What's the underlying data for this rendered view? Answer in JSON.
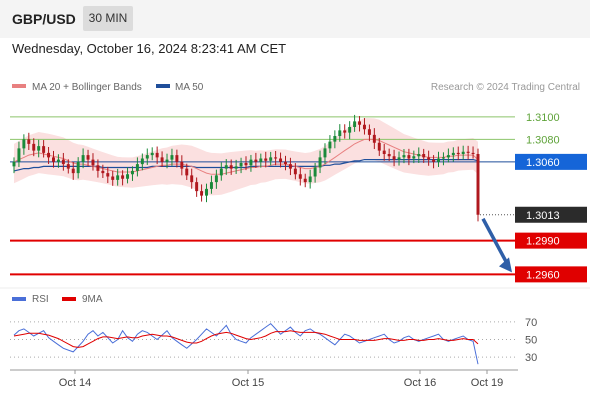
{
  "header": {
    "symbol": "GBP/USD",
    "timeframe": "30 MIN"
  },
  "datetime": "Wednesday, October 16, 2024 8:23:41 AM CET",
  "legend": {
    "ma20": "MA 20 + Bollinger Bands",
    "ma50": "MA 50",
    "credit": "Research © 2024 Trading Central",
    "rsi": "RSI",
    "rsi_ma": "9MA"
  },
  "colors": {
    "ma20": "#e88080",
    "ma50": "#1f4e9a",
    "band_fill": "#fbe0e0",
    "up_candle": "#1a8a3a",
    "down_candle": "#b0181e",
    "resistance": "#8cc46a",
    "support": "#e00000",
    "pivot_label": "#1565d8",
    "price_label": "#2b2b2b",
    "arrow": "#2f5fa8",
    "rsi": "#4a6fd8",
    "rsi_ma": "#e00000"
  },
  "chart_data": [
    {
      "type": "candlestick",
      "x_ticks": [
        "Oct 14",
        "Oct 15",
        "Oct 16",
        "Oct 19"
      ],
      "ylim": [
        1.2955,
        1.3115
      ],
      "levels": [
        {
          "value": 1.31,
          "label": "1.3100",
          "kind": "resistance"
        },
        {
          "value": 1.308,
          "label": "1.3080",
          "kind": "resistance"
        },
        {
          "value": 1.306,
          "label": "1.3060",
          "kind": "pivot"
        },
        {
          "value": 1.3013,
          "label": "1.3013",
          "kind": "last_price"
        },
        {
          "value": 1.299,
          "label": "1.2990",
          "kind": "support"
        },
        {
          "value": 1.296,
          "label": "1.2960",
          "kind": "support"
        }
      ],
      "closes": [
        1.306,
        1.3072,
        1.308,
        1.3076,
        1.307,
        1.3074,
        1.3068,
        1.3064,
        1.306,
        1.3062,
        1.3058,
        1.3054,
        1.305,
        1.306,
        1.3066,
        1.3062,
        1.3057,
        1.3052,
        1.305,
        1.3047,
        1.3044,
        1.3048,
        1.3045,
        1.3049,
        1.3052,
        1.3058,
        1.3063,
        1.3066,
        1.3068,
        1.3064,
        1.306,
        1.3062,
        1.3066,
        1.306,
        1.3054,
        1.3048,
        1.3042,
        1.3034,
        1.303,
        1.3036,
        1.3042,
        1.3048,
        1.3054,
        1.3057,
        1.3054,
        1.3056,
        1.3059,
        1.3057,
        1.3062,
        1.306,
        1.3063,
        1.3061,
        1.3064,
        1.3063,
        1.306,
        1.3058,
        1.3054,
        1.3049,
        1.3045,
        1.3042,
        1.3047,
        1.3055,
        1.3064,
        1.3072,
        1.3078,
        1.3083,
        1.3088,
        1.3086,
        1.3091,
        1.3096,
        1.3093,
        1.3089,
        1.3084,
        1.3077,
        1.307,
        1.3067,
        1.3065,
        1.3062,
        1.3064,
        1.3066,
        1.3063,
        1.3065,
        1.3067,
        1.3064,
        1.3062,
        1.306,
        1.3063,
        1.3064,
        1.3066,
        1.3068,
        1.3067,
        1.3069,
        1.3068,
        1.3067,
        1.3013
      ],
      "ma20": [
        1.306,
        1.3062,
        1.3064,
        1.3066,
        1.3067,
        1.3068,
        1.3067,
        1.3066,
        1.3065,
        1.3064,
        1.3063,
        1.3061,
        1.3059,
        1.3058,
        1.3058,
        1.3057,
        1.3056,
        1.3055,
        1.3054,
        1.3053,
        1.3052,
        1.3051,
        1.3051,
        1.3051,
        1.3051,
        1.3052,
        1.3053,
        1.3054,
        1.3055,
        1.3056,
        1.3057,
        1.3057,
        1.3058,
        1.3058,
        1.3058,
        1.3057,
        1.3056,
        1.3054,
        1.3052,
        1.305,
        1.3049,
        1.3049,
        1.3049,
        1.305,
        1.3051,
        1.3052,
        1.3053,
        1.3054,
        1.3055,
        1.3055,
        1.3056,
        1.3056,
        1.3057,
        1.3058,
        1.3058,
        1.3058,
        1.3057,
        1.3056,
        1.3055,
        1.3054,
        1.3054,
        1.3055,
        1.3056,
        1.3058,
        1.3061,
        1.3064,
        1.3067,
        1.307,
        1.3073,
        1.3076,
        1.3078,
        1.308,
        1.308,
        1.308,
        1.3079,
        1.3077,
        1.3075,
        1.3073,
        1.3071,
        1.3069,
        1.3068,
        1.3067,
        1.3066,
        1.3065,
        1.3064,
        1.3064,
        1.3064,
        1.3064,
        1.3065,
        1.3065,
        1.3066,
        1.3066,
        1.3066,
        1.3066,
        1.3062
      ],
      "ma50": [
        1.3052,
        1.3053,
        1.3054,
        1.3054,
        1.3055,
        1.3055,
        1.3056,
        1.3056,
        1.3056,
        1.3056,
        1.3056,
        1.3056,
        1.3056,
        1.3056,
        1.3056,
        1.3056,
        1.3056,
        1.3056,
        1.3055,
        1.3055,
        1.3055,
        1.3055,
        1.3055,
        1.3055,
        1.3055,
        1.3055,
        1.3055,
        1.3055,
        1.3056,
        1.3056,
        1.3056,
        1.3056,
        1.3056,
        1.3056,
        1.3056,
        1.3056,
        1.3056,
        1.3055,
        1.3055,
        1.3055,
        1.3055,
        1.3055,
        1.3055,
        1.3055,
        1.3055,
        1.3055,
        1.3055,
        1.3055,
        1.3056,
        1.3056,
        1.3056,
        1.3056,
        1.3056,
        1.3056,
        1.3056,
        1.3056,
        1.3056,
        1.3056,
        1.3056,
        1.3056,
        1.3056,
        1.3056,
        1.3056,
        1.3057,
        1.3057,
        1.3058,
        1.3058,
        1.3059,
        1.306,
        1.3061,
        1.3061,
        1.3062,
        1.3062,
        1.3062,
        1.3062,
        1.3062,
        1.3062,
        1.3062,
        1.3062,
        1.3062,
        1.3062,
        1.3062,
        1.3062,
        1.3062,
        1.3062,
        1.3062,
        1.3062,
        1.3062,
        1.3062,
        1.3062,
        1.3062,
        1.3062,
        1.3062,
        1.3062,
        1.3061
      ]
    },
    {
      "type": "line",
      "name": "RSI",
      "ylim": [
        20,
        80
      ],
      "y_ticks": [
        70,
        50,
        30
      ],
      "rsi": [
        55,
        60,
        62,
        58,
        54,
        57,
        60,
        52,
        48,
        44,
        40,
        38,
        36,
        42,
        48,
        56,
        60,
        54,
        58,
        52,
        46,
        50,
        60,
        52,
        48,
        56,
        60,
        58,
        54,
        50,
        55,
        60,
        52,
        48,
        44,
        40,
        45,
        50,
        56,
        62,
        58,
        54,
        60,
        66,
        56,
        50,
        48,
        46,
        52,
        56,
        60,
        64,
        68,
        62,
        56,
        60,
        64,
        58,
        54,
        60,
        62,
        58,
        56,
        52,
        48,
        44,
        50,
        56,
        54,
        50,
        46,
        48,
        50,
        52,
        54,
        56,
        50,
        46,
        48,
        52,
        54,
        50,
        48,
        50,
        52,
        54,
        56,
        50,
        48,
        50,
        52,
        54,
        50,
        48,
        22
      ],
      "rsi_ma": [
        54,
        55,
        56,
        57,
        57,
        57,
        56,
        55,
        53,
        51,
        48,
        45,
        42,
        41,
        42,
        45,
        48,
        51,
        53,
        53,
        52,
        51,
        52,
        53,
        52,
        52,
        54,
        55,
        56,
        55,
        54,
        54,
        53,
        51,
        49,
        47,
        46,
        46,
        48,
        51,
        54,
        56,
        57,
        58,
        57,
        55,
        53,
        51,
        50,
        51,
        52,
        54,
        57,
        59,
        59,
        59,
        60,
        59,
        58,
        58,
        58,
        58,
        57,
        56,
        54,
        52,
        50,
        50,
        50,
        50,
        49,
        49,
        49,
        49,
        50,
        51,
        51,
        50,
        49,
        49,
        50,
        50,
        49,
        49,
        50,
        50,
        51,
        50,
        49,
        49,
        50,
        51,
        50,
        50,
        45
      ]
    }
  ]
}
